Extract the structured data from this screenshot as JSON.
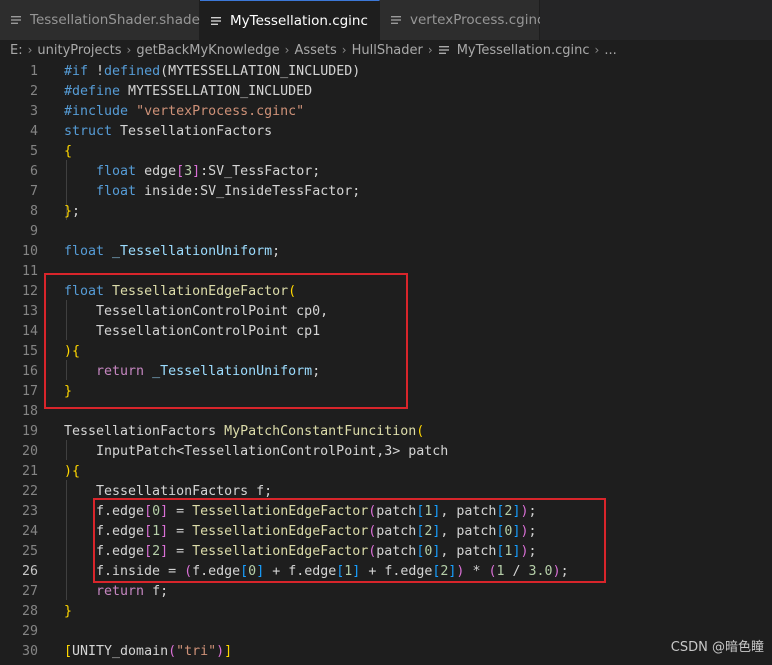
{
  "tabs": [
    {
      "label": "TessellationShader.shader",
      "icon": "lines-file-icon",
      "active": false
    },
    {
      "label": "MyTessellation.cginc",
      "icon": "lines-file-icon",
      "active": true,
      "close": "✕"
    },
    {
      "label": "vertexProcess.cginc",
      "icon": "lines-file-icon",
      "active": false
    }
  ],
  "breadcrumb": [
    "E:",
    "unityProjects",
    "getBackMyKnowledge",
    "Assets",
    "HullShader",
    "MyTessellation.cginc",
    "..."
  ],
  "editor": {
    "current_line": 26,
    "lines": [
      {
        "n": "1",
        "tokens": [
          [
            "tk-macro",
            "#if "
          ],
          [
            "tk-plain",
            "!"
          ],
          [
            "tk-kw",
            "defined"
          ],
          [
            "tk-plain",
            "(MYTESSELLATION_INCLUDED)"
          ]
        ]
      },
      {
        "n": "2",
        "tokens": [
          [
            "tk-macro",
            "#define "
          ],
          [
            "tk-plain",
            "MYTESSELLATION_INCLUDED"
          ]
        ]
      },
      {
        "n": "3",
        "tokens": [
          [
            "tk-macro",
            "#include "
          ],
          [
            "tk-str",
            "\"vertexProcess.cginc\""
          ]
        ]
      },
      {
        "n": "4",
        "tokens": [
          [
            "tk-kw",
            "struct "
          ],
          [
            "tk-plain",
            "TessellationFactors"
          ]
        ]
      },
      {
        "n": "5",
        "tokens": [
          [
            "tk-p1",
            "{"
          ]
        ]
      },
      {
        "n": "6",
        "tokens": [
          [
            "tk-plain",
            "    "
          ],
          [
            "tk-kw",
            "float "
          ],
          [
            "tk-plain",
            "edge"
          ],
          [
            "tk-p2",
            "["
          ],
          [
            "tk-num",
            "3"
          ],
          [
            "tk-p2",
            "]"
          ],
          [
            "tk-plain",
            ":SV_TessFactor;"
          ]
        ]
      },
      {
        "n": "7",
        "tokens": [
          [
            "tk-plain",
            "    "
          ],
          [
            "tk-kw",
            "float "
          ],
          [
            "tk-plain",
            "inside:SV_InsideTessFactor;"
          ]
        ]
      },
      {
        "n": "8",
        "tokens": [
          [
            "tk-p1",
            "}"
          ],
          [
            "tk-plain",
            ";"
          ]
        ]
      },
      {
        "n": "9",
        "tokens": []
      },
      {
        "n": "10",
        "tokens": [
          [
            "tk-kw",
            "float "
          ],
          [
            "tk-var",
            "_TessellationUniform"
          ],
          [
            "tk-plain",
            ";"
          ]
        ]
      },
      {
        "n": "11",
        "tokens": []
      },
      {
        "n": "12",
        "tokens": [
          [
            "tk-kw",
            "float "
          ],
          [
            "tk-fn",
            "TessellationEdgeFactor"
          ],
          [
            "tk-p1",
            "("
          ]
        ]
      },
      {
        "n": "13",
        "tokens": [
          [
            "tk-plain",
            "    TessellationControlPoint cp0,"
          ]
        ]
      },
      {
        "n": "14",
        "tokens": [
          [
            "tk-plain",
            "    TessellationControlPoint cp1"
          ]
        ]
      },
      {
        "n": "15",
        "tokens": [
          [
            "tk-p1",
            ")"
          ],
          [
            "tk-p1",
            "{"
          ]
        ]
      },
      {
        "n": "16",
        "tokens": [
          [
            "tk-plain",
            "    "
          ],
          [
            "tk-ctrl",
            "return "
          ],
          [
            "tk-var",
            "_TessellationUniform"
          ],
          [
            "tk-plain",
            ";"
          ]
        ]
      },
      {
        "n": "17",
        "tokens": [
          [
            "tk-p1",
            "}"
          ]
        ]
      },
      {
        "n": "18",
        "tokens": []
      },
      {
        "n": "19",
        "tokens": [
          [
            "tk-plain",
            "TessellationFactors "
          ],
          [
            "tk-fn",
            "MyPatchConstantFuncition"
          ],
          [
            "tk-p1",
            "("
          ]
        ]
      },
      {
        "n": "20",
        "tokens": [
          [
            "tk-plain",
            "    InputPatch<TessellationControlPoint,3> patch"
          ]
        ]
      },
      {
        "n": "21",
        "tokens": [
          [
            "tk-p1",
            ")"
          ],
          [
            "tk-p1",
            "{"
          ]
        ]
      },
      {
        "n": "22",
        "tokens": [
          [
            "tk-plain",
            "    TessellationFactors f;"
          ]
        ]
      },
      {
        "n": "23",
        "tokens": [
          [
            "tk-plain",
            "    f.edge"
          ],
          [
            "tk-p2",
            "["
          ],
          [
            "tk-num",
            "0"
          ],
          [
            "tk-p2",
            "]"
          ],
          [
            "tk-plain",
            " = "
          ],
          [
            "tk-fn",
            "TessellationEdgeFactor"
          ],
          [
            "tk-p2",
            "("
          ],
          [
            "tk-plain",
            "patch"
          ],
          [
            "tk-p3",
            "["
          ],
          [
            "tk-num",
            "1"
          ],
          [
            "tk-p3",
            "]"
          ],
          [
            "tk-plain",
            ", patch"
          ],
          [
            "tk-p3",
            "["
          ],
          [
            "tk-num",
            "2"
          ],
          [
            "tk-p3",
            "]"
          ],
          [
            "tk-p2",
            ")"
          ],
          [
            "tk-plain",
            ";"
          ]
        ]
      },
      {
        "n": "24",
        "tokens": [
          [
            "tk-plain",
            "    f.edge"
          ],
          [
            "tk-p2",
            "["
          ],
          [
            "tk-num",
            "1"
          ],
          [
            "tk-p2",
            "]"
          ],
          [
            "tk-plain",
            " = "
          ],
          [
            "tk-fn",
            "TessellationEdgeFactor"
          ],
          [
            "tk-p2",
            "("
          ],
          [
            "tk-plain",
            "patch"
          ],
          [
            "tk-p3",
            "["
          ],
          [
            "tk-num",
            "2"
          ],
          [
            "tk-p3",
            "]"
          ],
          [
            "tk-plain",
            ", patch"
          ],
          [
            "tk-p3",
            "["
          ],
          [
            "tk-num",
            "0"
          ],
          [
            "tk-p3",
            "]"
          ],
          [
            "tk-p2",
            ")"
          ],
          [
            "tk-plain",
            ";"
          ]
        ]
      },
      {
        "n": "25",
        "tokens": [
          [
            "tk-plain",
            "    f.edge"
          ],
          [
            "tk-p2",
            "["
          ],
          [
            "tk-num",
            "2"
          ],
          [
            "tk-p2",
            "]"
          ],
          [
            "tk-plain",
            " = "
          ],
          [
            "tk-fn",
            "TessellationEdgeFactor"
          ],
          [
            "tk-p2",
            "("
          ],
          [
            "tk-plain",
            "patch"
          ],
          [
            "tk-p3",
            "["
          ],
          [
            "tk-num",
            "0"
          ],
          [
            "tk-p3",
            "]"
          ],
          [
            "tk-plain",
            ", patch"
          ],
          [
            "tk-p3",
            "["
          ],
          [
            "tk-num",
            "1"
          ],
          [
            "tk-p3",
            "]"
          ],
          [
            "tk-p2",
            ")"
          ],
          [
            "tk-plain",
            ";"
          ]
        ]
      },
      {
        "n": "26",
        "tokens": [
          [
            "tk-plain",
            "    f.inside = "
          ],
          [
            "tk-p2",
            "("
          ],
          [
            "tk-plain",
            "f.edge"
          ],
          [
            "tk-p3",
            "["
          ],
          [
            "tk-num",
            "0"
          ],
          [
            "tk-p3",
            "]"
          ],
          [
            "tk-plain",
            " + f.edge"
          ],
          [
            "tk-p3",
            "["
          ],
          [
            "tk-num",
            "1"
          ],
          [
            "tk-p3",
            "]"
          ],
          [
            "tk-plain",
            " + f.edge"
          ],
          [
            "tk-p3",
            "["
          ],
          [
            "tk-num",
            "2"
          ],
          [
            "tk-p3",
            "]"
          ],
          [
            "tk-p2",
            ")"
          ],
          [
            "tk-plain",
            " * "
          ],
          [
            "tk-p2",
            "("
          ],
          [
            "tk-num",
            "1"
          ],
          [
            "tk-plain",
            " / "
          ],
          [
            "tk-num",
            "3.0"
          ],
          [
            "tk-p2",
            ")"
          ],
          [
            "tk-plain",
            ";"
          ]
        ]
      },
      {
        "n": "27",
        "tokens": [
          [
            "tk-plain",
            "    "
          ],
          [
            "tk-ctrl",
            "return "
          ],
          [
            "tk-plain",
            "f;"
          ]
        ]
      },
      {
        "n": "28",
        "tokens": [
          [
            "tk-p1",
            "}"
          ]
        ]
      },
      {
        "n": "29",
        "tokens": []
      },
      {
        "n": "30",
        "tokens": [
          [
            "tk-p1",
            "["
          ],
          [
            "tk-plain",
            "UNITY_domain"
          ],
          [
            "tk-p2",
            "("
          ],
          [
            "tk-str",
            "\"tri\""
          ],
          [
            "tk-p2",
            ")"
          ],
          [
            "tk-p1",
            "]"
          ]
        ]
      }
    ]
  },
  "watermark": "CSDN @暗色瞳",
  "colors": {
    "accent": "#3c78d8",
    "highlight_box": "#d9252b",
    "background": "#1e1e1e"
  }
}
